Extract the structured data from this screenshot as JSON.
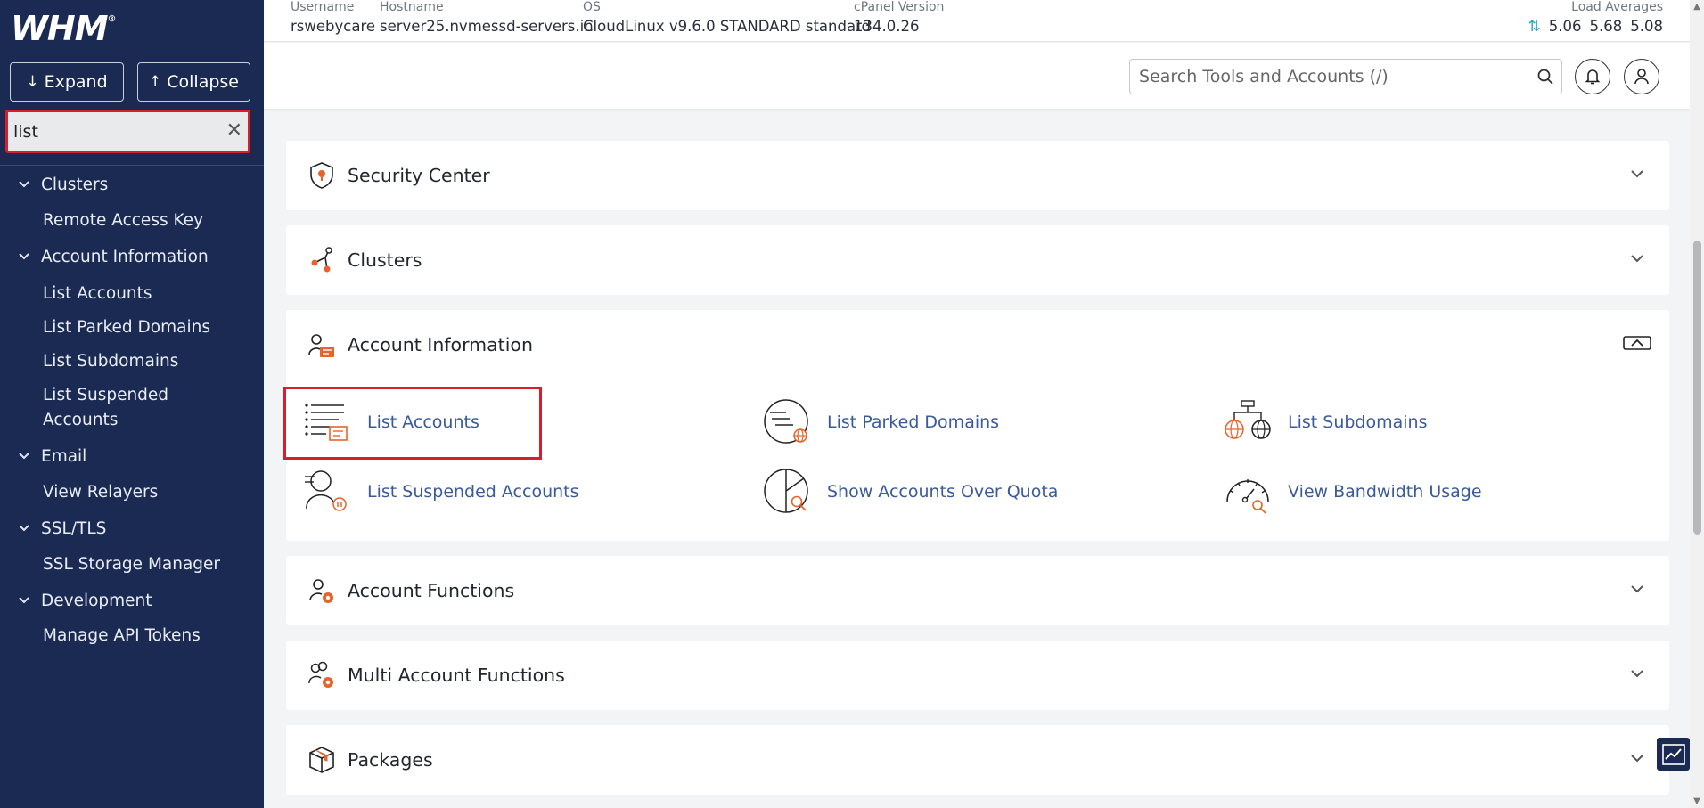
{
  "brand": {
    "logo_text": "WHM",
    "logo_mark": "®"
  },
  "sidebar": {
    "expand_label": "Expand",
    "collapse_label": "Collapse",
    "filter_value": "list",
    "groups": [
      {
        "label": "Clusters",
        "items": [
          "Remote Access Key"
        ]
      },
      {
        "label": "Account Information",
        "items": [
          "List Accounts",
          "List Parked Domains",
          "List Subdomains",
          "List Suspended Accounts"
        ]
      },
      {
        "label": "Email",
        "items": [
          "View Relayers"
        ]
      },
      {
        "label": "SSL/TLS",
        "items": [
          "SSL Storage Manager"
        ]
      },
      {
        "label": "Development",
        "items": [
          "Manage API Tokens"
        ]
      }
    ]
  },
  "header": {
    "username_label": "Username",
    "username": "rswebycare",
    "hostname_label": "Hostname",
    "hostname": "server25.nvmessd-servers.in",
    "os_label": "OS",
    "os": "CloudLinux v9.6.0 STANDARD standard",
    "cpanel_label": "cPanel Version",
    "cpanel_version": "134.0.26",
    "load_label": "Load Averages",
    "load_1": "5.06",
    "load_2": "5.68",
    "load_3": "5.08",
    "search_placeholder": "Search Tools and Accounts (/)"
  },
  "sections": {
    "security_center": "Security Center",
    "clusters": "Clusters",
    "account_information": "Account Information",
    "account_functions": "Account Functions",
    "multi_account_functions": "Multi Account Functions",
    "packages": "Packages"
  },
  "account_information_tools": {
    "list_accounts": "List Accounts",
    "list_parked_domains": "List Parked Domains",
    "list_subdomains": "List Subdomains",
    "list_suspended_accounts": "List Suspended Accounts",
    "show_accounts_over_quota": "Show Accounts Over Quota",
    "view_bandwidth_usage": "View Bandwidth Usage"
  },
  "colors": {
    "sidebar_bg": "#1b2a52",
    "accent_orange": "#e8632b",
    "link_blue": "#3a5a9c",
    "highlight_red": "#d61f2c"
  }
}
